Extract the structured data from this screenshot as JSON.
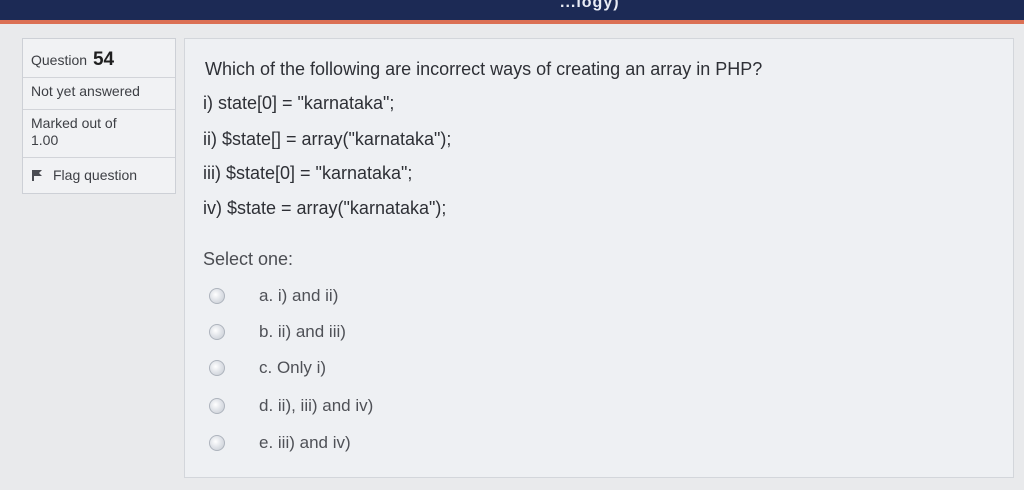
{
  "header": {
    "partial_title": "...logy)"
  },
  "info": {
    "question_label": "Question",
    "question_number": "54",
    "status": "Not yet answered",
    "marked_line1": "Marked out of",
    "marked_line2": "1.00",
    "flag_label": "Flag question"
  },
  "question": {
    "text": "Which of the following are incorrect ways of creating an array in PHP?",
    "statements": [
      "i) state[0] = \"karnataka\";",
      "ii) $state[] = array(\"karnataka\");",
      "iii) $state[0] = \"karnataka\";",
      "iv)  $state = array(\"karnataka\");"
    ],
    "select_prompt": "Select one:",
    "options": [
      "a. i) and ii)",
      "b. ii) and iii)",
      "c. Only i)",
      "d. ii), iii) and iv)",
      "e. iii) and iv)"
    ]
  },
  "colors": {
    "top_bar": "#1c2a55",
    "accent": "#d85a3a",
    "panel_bg": "#eef0f3"
  },
  "icons": {
    "flag": "flag-icon",
    "radio": "radio-unchecked-icon"
  }
}
